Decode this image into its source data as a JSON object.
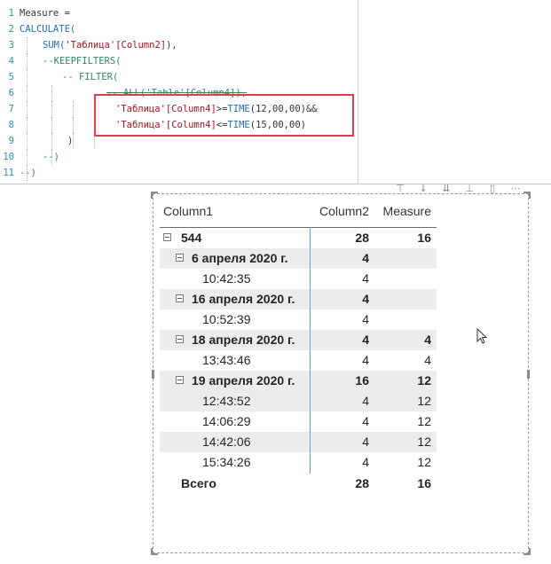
{
  "editor": {
    "lines": [
      {
        "n": "1",
        "tokens": [
          {
            "t": "Measure =",
            "c": "tx"
          }
        ]
      },
      {
        "n": "2",
        "tokens": [
          {
            "t": "CALCULATE(",
            "c": "kw"
          }
        ]
      },
      {
        "n": "3",
        "tokens": [
          {
            "t": "SUM(",
            "c": "fn"
          },
          {
            "t": "'Таблица'[Column2]",
            "c": "str"
          },
          {
            "t": "),",
            "c": "tx"
          }
        ]
      },
      {
        "n": "4",
        "tokens": [
          {
            "t": "--KEEPFILTERS(",
            "c": "cm"
          }
        ]
      },
      {
        "n": "5",
        "tokens": [
          {
            "t": "-- FILTER(",
            "c": "cm"
          }
        ]
      },
      {
        "n": "6",
        "tokens": [
          {
            "t": "-- ALL('Table'[Column4]),",
            "c": "cm strike"
          }
        ]
      },
      {
        "n": "7",
        "tokens": [
          {
            "t": "'Таблица'[Column4]",
            "c": "str"
          },
          {
            "t": ">=",
            "c": "tx"
          },
          {
            "t": "TIME",
            "c": "fn"
          },
          {
            "t": "(12,00,00)&&",
            "c": "tx"
          }
        ]
      },
      {
        "n": "8",
        "tokens": [
          {
            "t": "'Таблица'[Column4]",
            "c": "str"
          },
          {
            "t": "<=",
            "c": "tx"
          },
          {
            "t": "TIME",
            "c": "fn"
          },
          {
            "t": "(15,00,00)",
            "c": "tx"
          }
        ]
      },
      {
        "n": "9",
        "tokens": [
          {
            "t": ")",
            "c": "tx"
          }
        ]
      },
      {
        "n": "10",
        "tokens": [
          {
            "t": "--)",
            "c": "cm"
          }
        ]
      },
      {
        "n": "11",
        "tokens": [
          {
            "t": "--)",
            "c": "cm"
          }
        ]
      }
    ]
  },
  "toolbar": {
    "icons": [
      "pin-icon",
      "drill-down-icon",
      "expand-all-icon",
      "expand-next-icon",
      "focus-icon",
      "more-options-icon"
    ]
  },
  "matrix": {
    "headers": {
      "col1": "Column1",
      "col2": "Column2",
      "col3": "Measure"
    },
    "rows": [
      {
        "level": 0,
        "label": "544",
        "c2": "28",
        "c3": "16",
        "bold": true,
        "shade": false,
        "toggle": true
      },
      {
        "level": 1,
        "label": "6 апреля 2020 г.",
        "c2": "4",
        "c3": "",
        "bold": true,
        "shade": true,
        "toggle": true
      },
      {
        "level": 2,
        "label": "10:42:35",
        "c2": "4",
        "c3": "",
        "bold": false,
        "shade": false,
        "toggle": false
      },
      {
        "level": 1,
        "label": "16 апреля 2020 г.",
        "c2": "4",
        "c3": "",
        "bold": true,
        "shade": true,
        "toggle": true
      },
      {
        "level": 2,
        "label": "10:52:39",
        "c2": "4",
        "c3": "",
        "bold": false,
        "shade": false,
        "toggle": false
      },
      {
        "level": 1,
        "label": "18 апреля 2020 г.",
        "c2": "4",
        "c3": "4",
        "bold": true,
        "shade": true,
        "toggle": true
      },
      {
        "level": 2,
        "label": "13:43:46",
        "c2": "4",
        "c3": "4",
        "bold": false,
        "shade": false,
        "toggle": false
      },
      {
        "level": 1,
        "label": "19 апреля 2020 г.",
        "c2": "16",
        "c3": "12",
        "bold": true,
        "shade": true,
        "toggle": true
      },
      {
        "level": 2,
        "label": "12:43:52",
        "c2": "4",
        "c3": "12",
        "bold": false,
        "shade": true,
        "toggle": false
      },
      {
        "level": 2,
        "label": "14:06:29",
        "c2": "4",
        "c3": "12",
        "bold": false,
        "shade": false,
        "toggle": false
      },
      {
        "level": 2,
        "label": "14:42:06",
        "c2": "4",
        "c3": "12",
        "bold": false,
        "shade": true,
        "toggle": false
      },
      {
        "level": 2,
        "label": "15:34:26",
        "c2": "4",
        "c3": "12",
        "bold": false,
        "shade": false,
        "toggle": false
      }
    ],
    "total": {
      "label": "Всего",
      "c2": "28",
      "c3": "16"
    }
  }
}
